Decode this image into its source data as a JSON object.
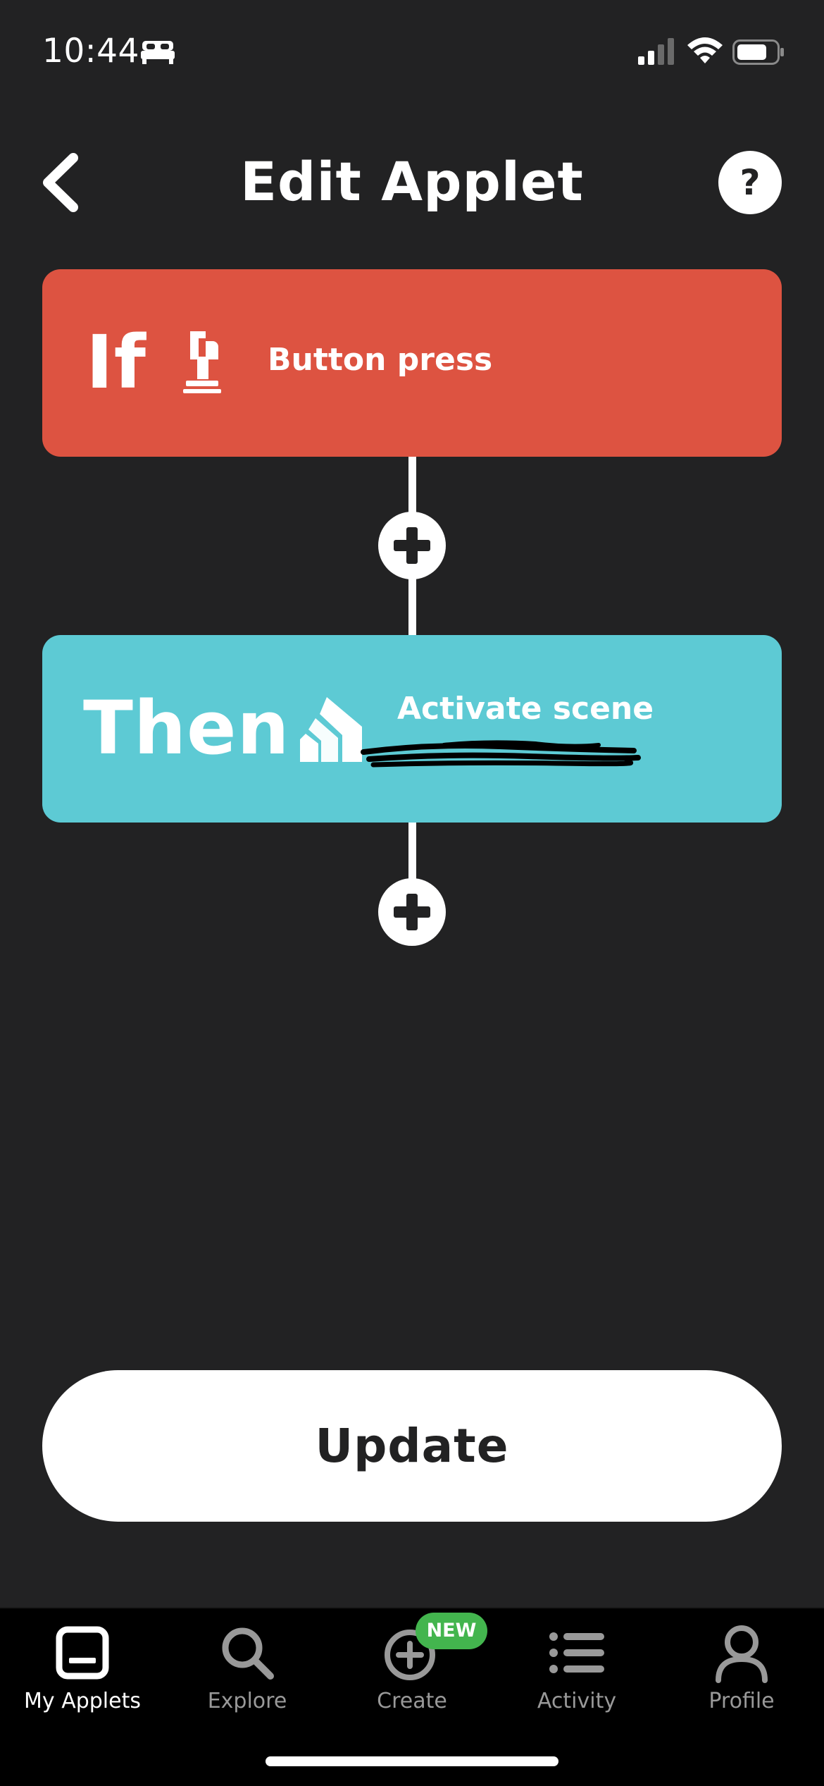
{
  "status_bar": {
    "time": "10:44"
  },
  "header": {
    "title": "Edit Applet",
    "help_label": "?"
  },
  "trigger": {
    "keyword": "If",
    "label": "Button press",
    "icon": "button-press-icon",
    "color": "#dd5341"
  },
  "action": {
    "keyword": "Then",
    "label": "Activate scene",
    "icon": "home-service-icon",
    "color": "#5dcad4"
  },
  "update_label": "Update",
  "tab_bar": {
    "tabs": [
      {
        "label": "My Applets",
        "icon": "my-applets-icon",
        "active": true
      },
      {
        "label": "Explore",
        "icon": "search-icon",
        "active": false
      },
      {
        "label": "Create",
        "icon": "plus-circle-icon",
        "active": false,
        "badge": "NEW"
      },
      {
        "label": "Activity",
        "icon": "list-icon",
        "active": false
      },
      {
        "label": "Profile",
        "icon": "user-icon",
        "active": false
      }
    ]
  },
  "colors": {
    "background": "#222223",
    "badge": "#43b54e"
  }
}
